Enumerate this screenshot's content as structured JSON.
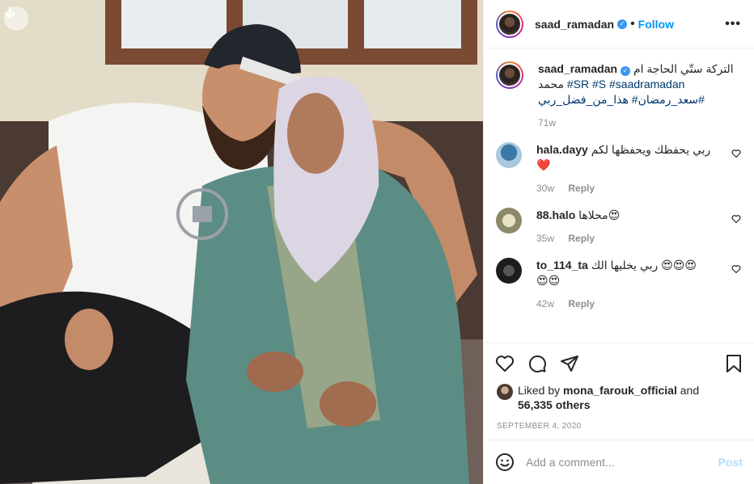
{
  "post": {
    "author": "saad_ramadan",
    "follow_label": "Follow",
    "dot": "•",
    "more_label": "•••",
    "caption_line1": "التركة ستّي الحاجة ام",
    "caption_line2_prefix": "محمد",
    "caption_tags_line2": "#SR #S #saadramadan",
    "caption_tags_line3": "سعد_رمضان# هذا_من_فضل_ربي#",
    "caption_time": "71w",
    "likes_prefix": "Liked by",
    "likes_user": "mona_farouk_official",
    "likes_and": "and",
    "likes_count": "56,335 others",
    "date": "SEPTEMBER 4, 2020",
    "comment_placeholder": "Add a comment...",
    "post_label": "Post"
  },
  "comments": [
    {
      "user": "hala.dayy",
      "text": "ربي يحفظك ويحفظها لكم",
      "emoji": "❤️",
      "time": "30w",
      "reply": "Reply"
    },
    {
      "user": "88.halo",
      "text": "محلاها😍",
      "emoji": "",
      "time": "35w",
      "reply": "Reply"
    },
    {
      "user": "to_114_ta",
      "text": "ربي يخليها الك 😍😍😍",
      "emoji": "😍😍",
      "time": "42w",
      "reply": "Reply"
    }
  ],
  "icons": [
    "scroll-down-icon",
    "verified-icon",
    "more-icon",
    "heart-icon",
    "comment-icon",
    "share-icon",
    "bookmark-icon",
    "emoji-icon"
  ],
  "colors": {
    "accent": "#0095f6",
    "text": "#262626",
    "muted": "#8e8e8e",
    "hashtag": "#00376b",
    "post_disabled": "#b2dffc"
  }
}
